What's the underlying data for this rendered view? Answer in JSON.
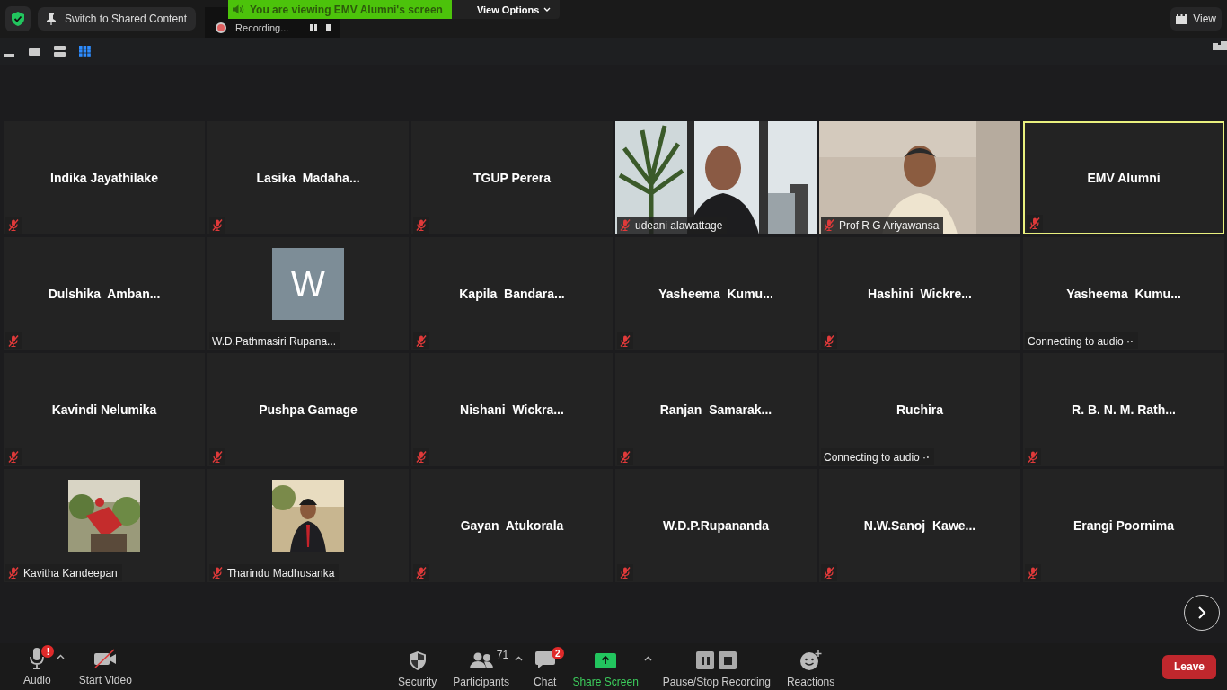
{
  "top_bar": {
    "switch_button": "Switch to Shared Content",
    "recording": "Recording...",
    "banner": "You are viewing EMV Alumni's screen",
    "view_options": "View Options",
    "view_button": "View"
  },
  "layout_modes": [
    {
      "selected": false
    },
    {
      "selected": false
    },
    {
      "selected": false
    },
    {
      "selected": true
    }
  ],
  "tiles": [
    {
      "name": "Indika Jayathilake",
      "kind": "name",
      "muted": true,
      "active": false
    },
    {
      "name": "Lasika  Madaha...",
      "kind": "name",
      "muted": true,
      "active": false
    },
    {
      "name": "TGUP Perera",
      "kind": "name",
      "muted": true,
      "active": false
    },
    {
      "name": "udeani alawattage",
      "kind": "video",
      "muted": true,
      "active": false
    },
    {
      "name": "Prof R G Ariyawansa",
      "kind": "video",
      "muted": true,
      "active": false
    },
    {
      "name": "EMV Alumni",
      "kind": "name",
      "muted": true,
      "active": true
    },
    {
      "name": "Dulshika  Amban...",
      "kind": "name",
      "muted": true,
      "active": false
    },
    {
      "name": "W.D.Pathmasiri Rupana...",
      "kind": "avatar",
      "initial": "W",
      "muted": false,
      "active": false
    },
    {
      "name": "Kapila  Bandara...",
      "kind": "name",
      "muted": true,
      "active": false
    },
    {
      "name": "Yasheema  Kumu...",
      "kind": "name",
      "muted": true,
      "active": false
    },
    {
      "name": "Hashini  Wickre...",
      "kind": "name",
      "muted": true,
      "active": false
    },
    {
      "name": "Yasheema  Kumu...",
      "kind": "name",
      "muted": false,
      "status": "Connecting to audio ·⋅",
      "active": false
    },
    {
      "name": "Kavindi Nelumika",
      "kind": "name",
      "muted": true,
      "active": false
    },
    {
      "name": "Pushpa Gamage",
      "kind": "name",
      "muted": true,
      "active": false
    },
    {
      "name": "Nishani  Wickra...",
      "kind": "name",
      "muted": true,
      "active": false
    },
    {
      "name": "Ranjan  Samarak...",
      "kind": "name",
      "muted": true,
      "active": false
    },
    {
      "name": "Ruchira",
      "kind": "name",
      "muted": false,
      "status": "Connecting to audio ·⋅",
      "active": false
    },
    {
      "name": "R. B. N. M. Rath...",
      "kind": "name",
      "muted": true,
      "active": false
    },
    {
      "name": "Kavitha Kandeepan",
      "muted": true,
      "active": false
    },
    {
      "name": "Tharindu Madhusanka",
      "muted": true,
      "active": false
    },
    {
      "name": "Gayan  Atukorala",
      "kind": "name",
      "muted": true,
      "active": false
    },
    {
      "name": "W.D.P.Rupananda",
      "kind": "name",
      "muted": true,
      "active": false
    },
    {
      "name": "N.W.Sanoj  Kawe...",
      "kind": "name",
      "muted": true,
      "active": false
    },
    {
      "name": "Erangi Poornima",
      "kind": "name",
      "muted": true,
      "active": false
    }
  ],
  "toolbar": [
    {
      "kind": "audio",
      "label": "Audio",
      "badge": "!",
      "menu": true,
      "highlighted": false
    },
    {
      "kind": "video",
      "label": "Start Video",
      "menu": false,
      "highlighted": false
    },
    {
      "kind": "security",
      "label": "Security",
      "menu": false,
      "highlighted": false
    },
    {
      "kind": "participants",
      "label": "Participants",
      "count": "71",
      "menu": true,
      "highlighted": false
    },
    {
      "kind": "chat",
      "label": "Chat",
      "badge": "2",
      "menu": false,
      "highlighted": false
    },
    {
      "kind": "share",
      "label": "Share Screen",
      "menu": true,
      "highlighted": true
    },
    {
      "kind": "record",
      "label": "Pause/Stop Recording",
      "menu": false,
      "highlighted": false
    },
    {
      "kind": "reactions",
      "label": "Reactions",
      "menu": false,
      "highlighted": false
    }
  ],
  "leave_button": "Leave"
}
